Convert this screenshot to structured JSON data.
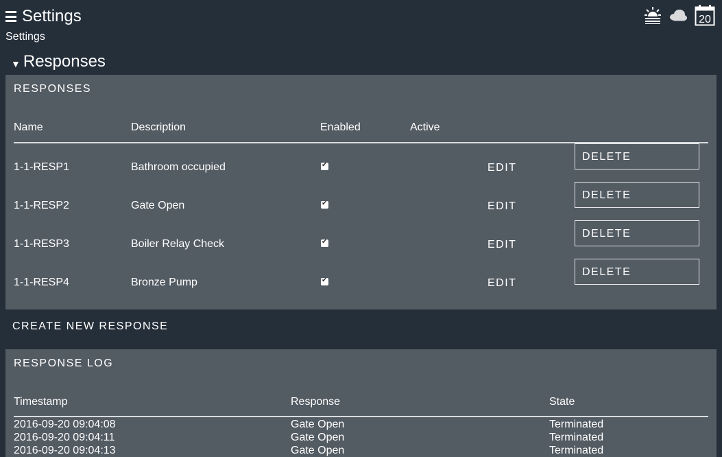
{
  "header": {
    "title": "Settings",
    "icons": [
      "menu-icon",
      "sunrise-icon",
      "cloud-icon",
      "calendar-icon"
    ],
    "calendar_day": "20"
  },
  "breadcrumb": "Settings",
  "section": {
    "title": "Responses",
    "expanded": true
  },
  "responses": {
    "heading": "RESPONSES",
    "columns": {
      "name": "Name",
      "description": "Description",
      "enabled": "Enabled",
      "active": "Active"
    },
    "edit_label": "EDIT",
    "delete_label": "DELETE",
    "rows": [
      {
        "name": "1-1-RESP1",
        "description": "Bathroom occupied",
        "enabled": true
      },
      {
        "name": "1-1-RESP2",
        "description": "Gate Open",
        "enabled": true
      },
      {
        "name": "1-1-RESP3",
        "description": "Boiler Relay Check",
        "enabled": true
      },
      {
        "name": "1-1-RESP4",
        "description": "Bronze Pump",
        "enabled": true
      }
    ]
  },
  "create_label": "CREATE NEW RESPONSE",
  "log": {
    "heading": "RESPONSE LOG",
    "columns": {
      "timestamp": "Timestamp",
      "response": "Response",
      "state": "State"
    },
    "rows": [
      {
        "timestamp": "2016-09-20 09:04:08",
        "response": "Gate Open",
        "state": "Terminated"
      },
      {
        "timestamp": "2016-09-20 09:04:11",
        "response": "Gate Open",
        "state": "Terminated"
      },
      {
        "timestamp": "2016-09-20 09:04:13",
        "response": "Gate Open",
        "state": "Terminated"
      }
    ]
  },
  "colors": {
    "background": "#252f3a",
    "panel": "#535b63",
    "text": "#ffffff"
  }
}
